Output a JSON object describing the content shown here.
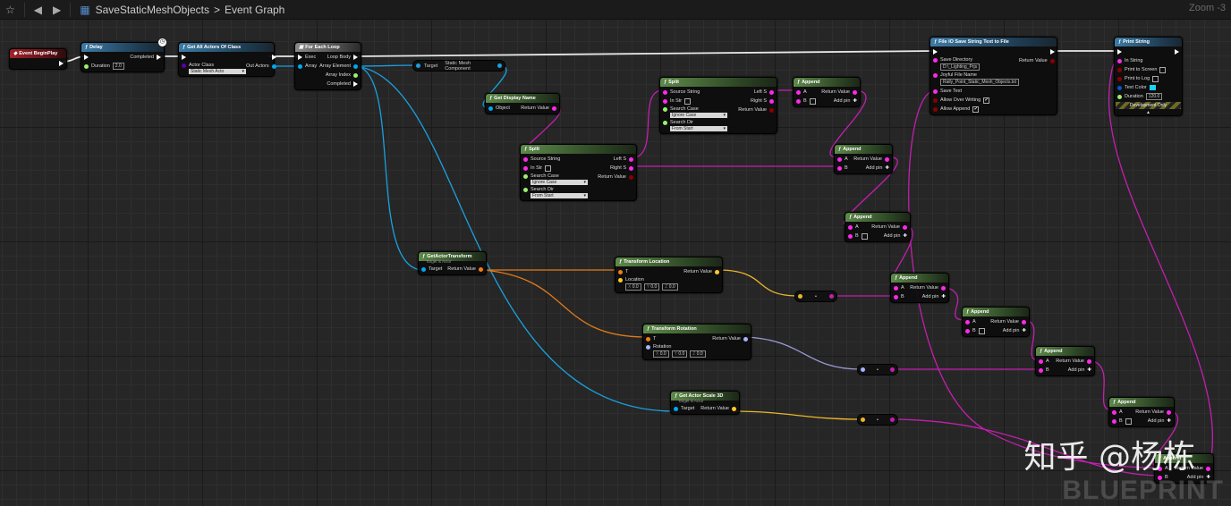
{
  "topbar": {
    "breadcrumb_root": "SaveStaticMeshObjects",
    "breadcrumb_sep": ">",
    "breadcrumb_current": "Event Graph",
    "zoom": "Zoom -3"
  },
  "watermark": {
    "zhihu": "知乎 @杨栋",
    "blueprint": "BLUEPRINT"
  },
  "colors": {
    "exec": "#ffffff",
    "object": "#00a8f2",
    "string": "#ff29ea",
    "vector": "#fdc82b",
    "rotator": "#a6b4ff",
    "transform": "#f07d17",
    "bool": "#8a0000",
    "struct": "#0059cb",
    "float": "#9bef6f",
    "class": "#5800a8"
  },
  "nodes": [
    {
      "id": "begin",
      "title": "Event BeginPlay",
      "style": "red",
      "left": [],
      "right": [
        {
          "type": "exec",
          "label": ""
        }
      ]
    },
    {
      "id": "delay",
      "title": "Delay",
      "style": "blue",
      "left": [
        {
          "type": "exec",
          "label": ""
        },
        {
          "type": "float",
          "label": "Duration",
          "value": "2.0"
        }
      ],
      "right": [
        {
          "type": "exec",
          "label": "Completed"
        }
      ]
    },
    {
      "id": "getall",
      "title": "Get All Actors Of Class",
      "style": "blue",
      "left": [
        {
          "type": "exec",
          "label": ""
        },
        {
          "type": "class",
          "label": "Actor Class",
          "select": "Static Mesh Acto"
        }
      ],
      "right": [
        {
          "type": "exec",
          "label": ""
        },
        {
          "type": "object",
          "label": "Out Actors"
        }
      ]
    },
    {
      "id": "foreach",
      "title": "For Each Loop",
      "style": "gray",
      "left": [
        {
          "type": "exec",
          "label": "Exec"
        },
        {
          "type": "object",
          "label": "Array"
        }
      ],
      "right": [
        {
          "type": "exec",
          "label": "Loop Body"
        },
        {
          "type": "object",
          "label": "Array Element"
        },
        {
          "type": "float",
          "label": "Array Index"
        },
        {
          "type": "exec",
          "label": "Completed"
        }
      ]
    },
    {
      "id": "displayname",
      "title": "Get Display Name",
      "style": "green",
      "left": [
        {
          "type": "object",
          "label": "Object"
        }
      ],
      "right": [
        {
          "type": "string",
          "label": "Return Value"
        }
      ]
    },
    {
      "id": "split1",
      "title": "Split",
      "style": "green",
      "left": [
        {
          "type": "string",
          "label": "Source String"
        },
        {
          "type": "string",
          "label": "In Str",
          "check": ""
        },
        {
          "type": "float",
          "label": "Search Case",
          "select": "Ignore Case"
        },
        {
          "type": "float",
          "label": "Search Dir",
          "select": "From Start"
        }
      ],
      "right": [
        {
          "type": "string",
          "label": "Left S"
        },
        {
          "type": "string",
          "label": "Right S"
        },
        {
          "type": "bool",
          "label": "Return Value"
        }
      ]
    },
    {
      "id": "split2",
      "title": "Split",
      "style": "green",
      "left": [
        {
          "type": "string",
          "label": "Source String"
        },
        {
          "type": "string",
          "label": "In Str",
          "check": ""
        },
        {
          "type": "float",
          "label": "Search Case",
          "select": "Ignore Case"
        },
        {
          "type": "float",
          "label": "Search Dir",
          "select": "From Start"
        }
      ],
      "right": [
        {
          "type": "string",
          "label": "Left S"
        },
        {
          "type": "string",
          "label": "Right S"
        },
        {
          "type": "bool",
          "label": "Return Value"
        }
      ]
    },
    {
      "id": "append1",
      "title": "Append",
      "style": "green",
      "left": [
        {
          "type": "string",
          "label": "A"
        },
        {
          "type": "string",
          "label": "B",
          "check": ""
        }
      ],
      "right": [
        {
          "type": "string",
          "label": "Return Value"
        },
        {
          "type": "add",
          "label": "Add pin"
        }
      ]
    },
    {
      "id": "append2",
      "title": "Append",
      "style": "green",
      "left": [
        {
          "type": "string",
          "label": "A"
        },
        {
          "type": "string",
          "label": "B"
        }
      ],
      "right": [
        {
          "type": "string",
          "label": "Return Value"
        },
        {
          "type": "add",
          "label": "Add pin"
        }
      ]
    },
    {
      "id": "append3",
      "title": "Append",
      "style": "green",
      "left": [
        {
          "type": "string",
          "label": "A"
        },
        {
          "type": "string",
          "label": "B",
          "check": ""
        }
      ],
      "right": [
        {
          "type": "string",
          "label": "Return Value"
        },
        {
          "type": "add",
          "label": "Add pin"
        }
      ]
    },
    {
      "id": "append4",
      "title": "Append",
      "style": "green",
      "left": [
        {
          "type": "string",
          "label": "A"
        },
        {
          "type": "string",
          "label": "B"
        }
      ],
      "right": [
        {
          "type": "string",
          "label": "Return Value"
        },
        {
          "type": "add",
          "label": "Add pin"
        }
      ]
    },
    {
      "id": "append5",
      "title": "Append",
      "style": "green",
      "left": [
        {
          "type": "string",
          "label": "A"
        },
        {
          "type": "string",
          "label": "B",
          "check": ""
        }
      ],
      "right": [
        {
          "type": "string",
          "label": "Return Value"
        },
        {
          "type": "add",
          "label": "Add pin"
        }
      ]
    },
    {
      "id": "append6",
      "title": "Append",
      "style": "green",
      "left": [
        {
          "type": "string",
          "label": "A"
        },
        {
          "type": "string",
          "label": "B"
        }
      ],
      "right": [
        {
          "type": "string",
          "label": "Return Value"
        },
        {
          "type": "add",
          "label": "Add pin"
        }
      ]
    },
    {
      "id": "append7",
      "title": "Append",
      "style": "green",
      "left": [
        {
          "type": "string",
          "label": "A"
        },
        {
          "type": "string",
          "label": "B",
          "check": ""
        }
      ],
      "right": [
        {
          "type": "string",
          "label": "Return Value"
        },
        {
          "type": "add",
          "label": "Add pin"
        }
      ]
    },
    {
      "id": "append8",
      "title": "Append",
      "style": "green",
      "left": [
        {
          "type": "string",
          "label": "A"
        },
        {
          "type": "string",
          "label": "B"
        }
      ],
      "right": [
        {
          "type": "string",
          "label": "Return Value"
        },
        {
          "type": "add",
          "label": "Add pin"
        }
      ]
    },
    {
      "id": "gettransform",
      "title": "GetActorTransform",
      "subtitle": "Target is Actor",
      "style": "green",
      "left": [
        {
          "type": "object",
          "label": "Target"
        }
      ],
      "right": [
        {
          "type": "transform",
          "label": "Return Value"
        }
      ]
    },
    {
      "id": "tloc",
      "title": "Transform Location",
      "style": "green",
      "left": [
        {
          "type": "transform",
          "label": "T"
        },
        {
          "type": "vector",
          "label": "Location",
          "xyz": [
            "0.0",
            "0.0",
            "0.0"
          ]
        }
      ],
      "right": [
        {
          "type": "vector",
          "label": "Return Value"
        }
      ]
    },
    {
      "id": "trot",
      "title": "Transform Rotation",
      "style": "green",
      "left": [
        {
          "type": "transform",
          "label": "T"
        },
        {
          "type": "rotator",
          "label": "Rotation",
          "xyz": [
            "0.0",
            "0.0",
            "0.0"
          ]
        }
      ],
      "right": [
        {
          "type": "rotator",
          "label": "Return Value"
        }
      ]
    },
    {
      "id": "scale",
      "title": "Get Actor Scale 3D",
      "subtitle": "Target is Actor",
      "style": "green",
      "left": [
        {
          "type": "object",
          "label": "Target"
        }
      ],
      "right": [
        {
          "type": "vector",
          "label": "Return Value"
        }
      ]
    },
    {
      "id": "savefile",
      "title": "File IO  Save String Text to File",
      "style": "blue",
      "left": [
        {
          "type": "exec",
          "label": ""
        },
        {
          "type": "string",
          "label": "Save Directory",
          "value": "D:\\_Lighting_Prjs"
        },
        {
          "type": "string",
          "label": "Joyful File Name",
          "value": "Rally_Point_Static_Mesh_Objects.txt"
        },
        {
          "type": "string",
          "label": "Save Text"
        },
        {
          "type": "bool",
          "label": "Allow Over Writing",
          "check": "✔"
        },
        {
          "type": "bool",
          "label": "Allow Append",
          "check": "✔"
        }
      ],
      "right": [
        {
          "type": "exec",
          "label": ""
        },
        {
          "type": "bool",
          "label": "Return Value"
        }
      ]
    },
    {
      "id": "print",
      "title": "Print String",
      "style": "blue",
      "left": [
        {
          "type": "exec",
          "label": ""
        },
        {
          "type": "string",
          "label": "In String"
        },
        {
          "type": "bool",
          "label": "Print to Screen",
          "check": ""
        },
        {
          "type": "bool",
          "label": "Print to Log",
          "check": ""
        },
        {
          "type": "struct",
          "label": "Text Color",
          "swatch": "#19d3f5"
        },
        {
          "type": "float",
          "label": "Duration",
          "value": "120.0"
        }
      ],
      "right": [
        {
          "type": "exec",
          "label": ""
        }
      ],
      "footer": "Development Only"
    }
  ],
  "compact": {
    "target": "Target",
    "component": "Static Mesh Component"
  },
  "conversions": [
    "•",
    "•",
    "•"
  ]
}
